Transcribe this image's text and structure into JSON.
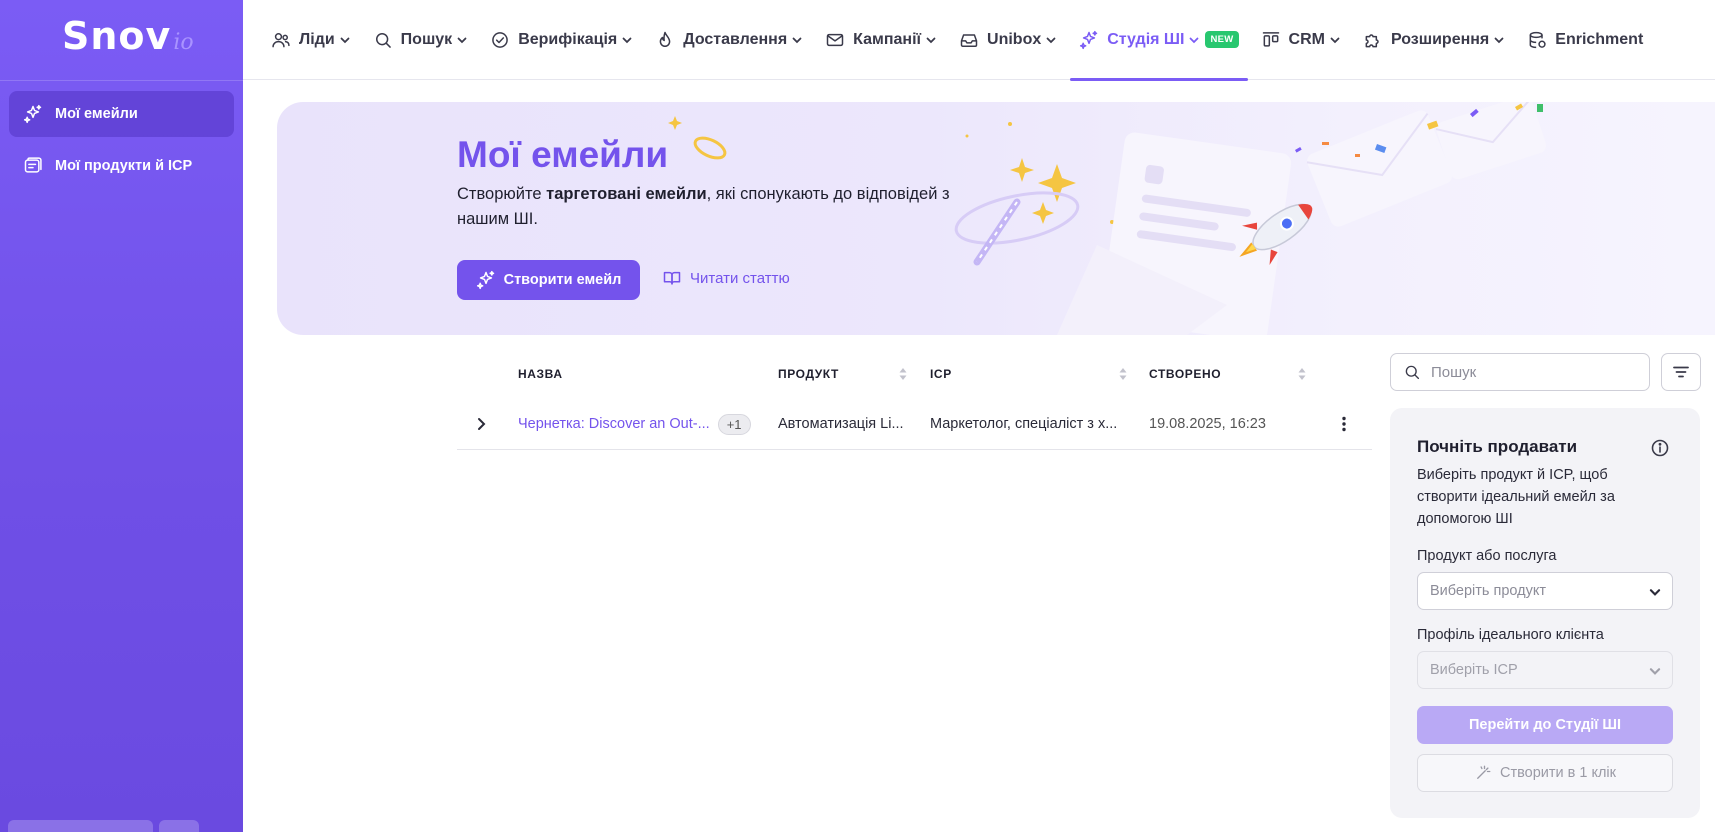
{
  "logo": {
    "main": "Snov",
    "suffix": "io"
  },
  "sidebar": {
    "items": [
      {
        "label": "Мої емейли",
        "icon": "sparkles-icon",
        "active": true
      },
      {
        "label": "Мої продукти й ICP",
        "icon": "product-list-icon",
        "active": false
      }
    ]
  },
  "nav": {
    "items": [
      {
        "label": "Ліди",
        "icon": "users-icon"
      },
      {
        "label": "Пошук",
        "icon": "search-icon"
      },
      {
        "label": "Верифікація",
        "icon": "check-circle-icon"
      },
      {
        "label": "Доставлення",
        "icon": "flame-icon"
      },
      {
        "label": "Кампанії",
        "icon": "mail-icon"
      },
      {
        "label": "Unibox",
        "icon": "inbox-icon"
      },
      {
        "label": "Студія ШІ",
        "icon": "sparkles-icon",
        "badge": "NEW",
        "active": true
      },
      {
        "label": "CRM",
        "icon": "kanban-icon"
      },
      {
        "label": "Розширення",
        "icon": "puzzle-icon"
      },
      {
        "label": "Enrichment",
        "icon": "database-icon"
      }
    ]
  },
  "banner": {
    "title": "Мої емейли",
    "subtitle_pre": "Створюйте ",
    "subtitle_bold": "таргетовані емейли",
    "subtitle_post": ", які спонукають до відповідей з нашим ШІ.",
    "create_button": "Створити емейл",
    "read_link": "Читати статтю"
  },
  "table": {
    "columns": [
      "НАЗВА",
      "ПРОДУКТ",
      "ICP",
      "СТВОРЕНО"
    ],
    "rows": [
      {
        "name": "Чернетка: Discover an Out-...",
        "extra": "+1",
        "product": "Автоматизація Li...",
        "icp": "Маркетолог, спеціаліст з х...",
        "created": "19.08.2025, 16:23"
      }
    ]
  },
  "search": {
    "placeholder": "Пошук"
  },
  "panel": {
    "title": "Почніть продавати",
    "description": "Виберіть продукт й ICP, щоб створити ідеальний емейл за допомогою ШІ",
    "product_label": "Продукт або послуга",
    "product_placeholder": "Виберіть продукт",
    "icp_label": "Профіль ідеального клієнта",
    "icp_placeholder": "Виберіть ICP",
    "studio_button": "Перейти до Студії ШІ",
    "oneclick_button": "Створити в 1 клік"
  },
  "colors": {
    "accent": "#7453ec",
    "sidebar": "#6f4fe6",
    "badge_new": "#28c76f"
  }
}
